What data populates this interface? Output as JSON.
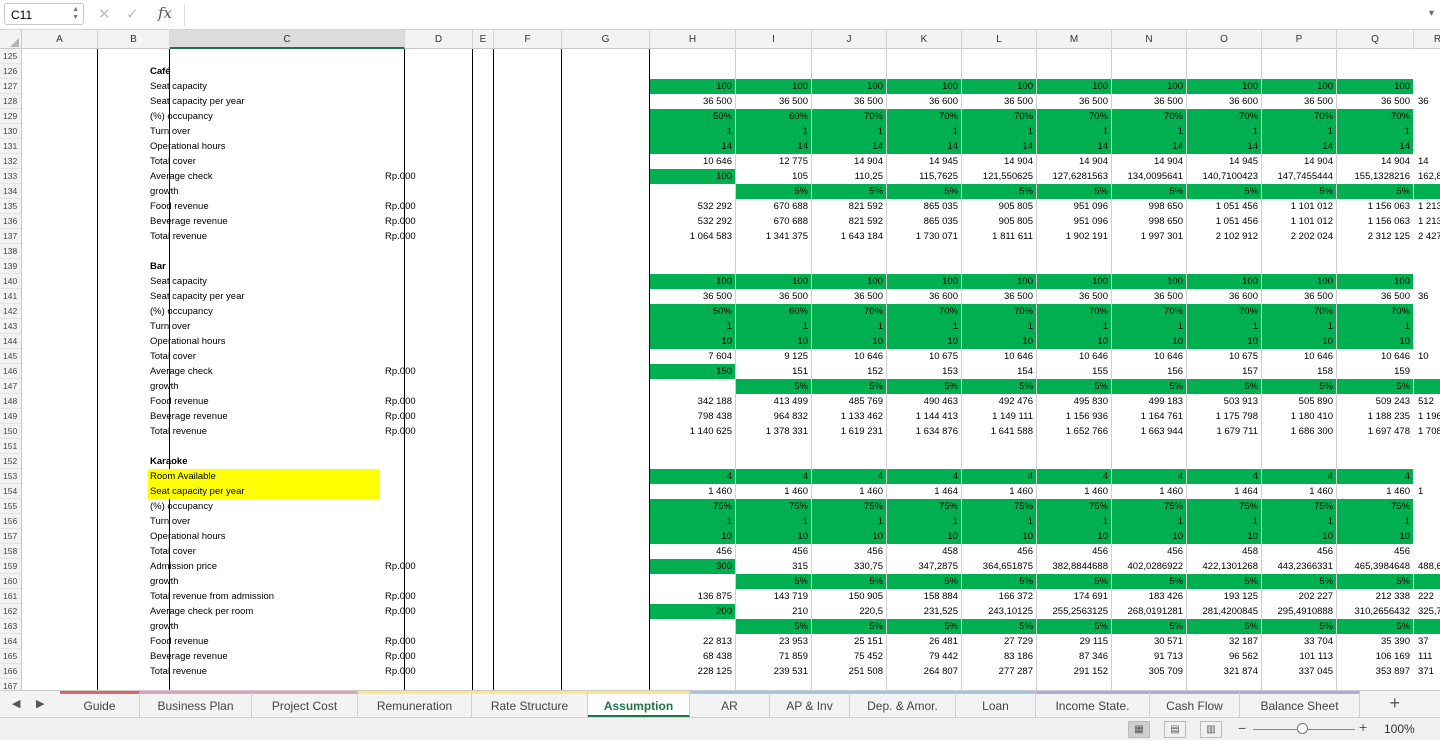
{
  "name_box": "C11",
  "formula_icons": {
    "cancel": "✕",
    "confirm": "✓",
    "fx": "fx",
    "dropdown": "▾"
  },
  "columns": [
    "A",
    "B",
    "C",
    "D",
    "E",
    "F",
    "G",
    "H",
    "I",
    "J",
    "K",
    "L",
    "M",
    "N",
    "O",
    "P",
    "Q",
    "R"
  ],
  "row_start": 125,
  "row_end": 167,
  "sections": [
    {
      "rows": [
        {
          "label": "Café",
          "bold": true
        },
        {
          "label": "Seat capacity",
          "green": true,
          "values": [
            "100",
            "100",
            "100",
            "100",
            "100",
            "100",
            "100",
            "100",
            "100",
            "100",
            ""
          ]
        },
        {
          "label": "Seat capacity per year",
          "values": [
            "36 500",
            "36 500",
            "36 500",
            "36 600",
            "36 500",
            "36 500",
            "36 500",
            "36 600",
            "36 500",
            "36 500",
            "36"
          ]
        },
        {
          "label": "(%) occupancy",
          "green": true,
          "values": [
            "50%",
            "60%",
            "70%",
            "70%",
            "70%",
            "70%",
            "70%",
            "70%",
            "70%",
            "70%",
            ""
          ]
        },
        {
          "label": "Turn over",
          "green": true,
          "values": [
            "1",
            "1",
            "1",
            "1",
            "1",
            "1",
            "1",
            "1",
            "1",
            "1",
            ""
          ]
        },
        {
          "label": "Operational hours",
          "green": true,
          "values": [
            "14",
            "14",
            "14",
            "14",
            "14",
            "14",
            "14",
            "14",
            "14",
            "14",
            ""
          ]
        },
        {
          "label": "Total cover",
          "values": [
            "10 646",
            "12 775",
            "14 904",
            "14 945",
            "14 904",
            "14 904",
            "14 904",
            "14 945",
            "14 904",
            "14 904",
            "14"
          ]
        },
        {
          "label": "Average check",
          "unit": "Rp.000",
          "values": [
            "100",
            "105",
            "110,25",
            "115,7625",
            "121,550625",
            "127,6281563",
            "134,0095641",
            "140,7100423",
            "147,7455444",
            "155,1328216",
            "162,889"
          ],
          "green_first": true
        },
        {
          "label": "growth",
          "green_rest": true,
          "values": [
            "",
            "5%",
            "5%",
            "5%",
            "5%",
            "5%",
            "5%",
            "5%",
            "5%",
            "5%",
            ""
          ]
        },
        {
          "label": "Food revenue",
          "unit": "Rp.000",
          "values": [
            "532 292",
            "670 688",
            "821 592",
            "865 035",
            "905 805",
            "951 096",
            "998 650",
            "1 051 456",
            "1 101 012",
            "1 156 063",
            "1 213"
          ]
        },
        {
          "label": "Beverage revenue",
          "unit": "Rp.000",
          "values": [
            "532 292",
            "670 688",
            "821 592",
            "865 035",
            "905 805",
            "951 096",
            "998 650",
            "1 051 456",
            "1 101 012",
            "1 156 063",
            "1 213"
          ]
        },
        {
          "label": "Total revenue",
          "unit": "Rp.000",
          "values": [
            "1 064 583",
            "1 341 375",
            "1 643 184",
            "1 730 071",
            "1 811 611",
            "1 902 191",
            "1 997 301",
            "2 102 912",
            "2 202 024",
            "2 312 125",
            "2 427"
          ]
        }
      ]
    }
  ],
  "bar_rows": [
    {
      "label": "Bar",
      "bold": true
    },
    {
      "label": "Seat capacity",
      "green": true,
      "values": [
        "100",
        "100",
        "100",
        "100",
        "100",
        "100",
        "100",
        "100",
        "100",
        "100",
        ""
      ]
    },
    {
      "label": "Seat capacity per year",
      "values": [
        "36 500",
        "36 500",
        "36 500",
        "36 600",
        "36 500",
        "36 500",
        "36 500",
        "36 600",
        "36 500",
        "36 500",
        "36"
      ]
    },
    {
      "label": "(%) occupancy",
      "green": true,
      "values": [
        "50%",
        "60%",
        "70%",
        "70%",
        "70%",
        "70%",
        "70%",
        "70%",
        "70%",
        "70%",
        ""
      ]
    },
    {
      "label": "Turn over",
      "green": true,
      "values": [
        "1",
        "1",
        "1",
        "1",
        "1",
        "1",
        "1",
        "1",
        "1",
        "1",
        ""
      ]
    },
    {
      "label": "Operational hours",
      "green": true,
      "values": [
        "10",
        "10",
        "10",
        "10",
        "10",
        "10",
        "10",
        "10",
        "10",
        "10",
        ""
      ]
    },
    {
      "label": "Total cover",
      "values": [
        "7 604",
        "9 125",
        "10 646",
        "10 675",
        "10 646",
        "10 646",
        "10 646",
        "10 675",
        "10 646",
        "10 646",
        "10"
      ]
    },
    {
      "label": "Average check",
      "unit": "Rp.000",
      "values": [
        "150",
        "151",
        "152",
        "153",
        "154",
        "155",
        "156",
        "157",
        "158",
        "159",
        ""
      ],
      "green_first": true
    },
    {
      "label": "growth",
      "green_rest": true,
      "values": [
        "",
        "5%",
        "5%",
        "5%",
        "5%",
        "5%",
        "5%",
        "5%",
        "5%",
        "5%",
        ""
      ]
    },
    {
      "label": "Food revenue",
      "unit": "Rp.000",
      "values": [
        "342 188",
        "413 499",
        "485 769",
        "490 463",
        "492 476",
        "495 830",
        "499 183",
        "503 913",
        "505 890",
        "509 243",
        "512"
      ]
    },
    {
      "label": "Beverage revenue",
      "unit": "Rp.000",
      "values": [
        "798 438",
        "964 832",
        "1 133 462",
        "1 144 413",
        "1 149 111",
        "1 156 936",
        "1 164 761",
        "1 175 798",
        "1 180 410",
        "1 188 235",
        "1 196"
      ]
    },
    {
      "label": "Total revenue",
      "unit": "Rp.000",
      "values": [
        "1 140 625",
        "1 378 331",
        "1 619 231",
        "1 634 876",
        "1 641 588",
        "1 652 766",
        "1 663 944",
        "1 679 711",
        "1 686 300",
        "1 697 478",
        "1 708"
      ]
    }
  ],
  "karaoke_rows": [
    {
      "label": "Karaoke",
      "bold": true
    },
    {
      "label": "Room Available",
      "yellow": true,
      "green": true,
      "values": [
        "4",
        "4",
        "4",
        "4",
        "4",
        "4",
        "4",
        "4",
        "4",
        "4",
        ""
      ]
    },
    {
      "label": "Seat capacity per year",
      "yellow": true,
      "values": [
        "1 460",
        "1 460",
        "1 460",
        "1 464",
        "1 460",
        "1 460",
        "1 460",
        "1 464",
        "1 460",
        "1 460",
        "1"
      ]
    },
    {
      "label": "(%) occupancy",
      "green": true,
      "values": [
        "75%",
        "75%",
        "75%",
        "75%",
        "75%",
        "75%",
        "75%",
        "75%",
        "75%",
        "75%",
        ""
      ]
    },
    {
      "label": "Turn over",
      "green": true,
      "values": [
        "1",
        "1",
        "1",
        "1",
        "1",
        "1",
        "1",
        "1",
        "1",
        "1",
        ""
      ]
    },
    {
      "label": "Operational hours",
      "green": true,
      "values": [
        "10",
        "10",
        "10",
        "10",
        "10",
        "10",
        "10",
        "10",
        "10",
        "10",
        ""
      ]
    },
    {
      "label": "Total cover",
      "values": [
        "456",
        "456",
        "456",
        "458",
        "456",
        "456",
        "456",
        "458",
        "456",
        "456",
        ""
      ]
    },
    {
      "label": "Admission price",
      "unit": "Rp.000",
      "values": [
        "300",
        "315",
        "330,75",
        "347,2875",
        "364,651875",
        "382,8844688",
        "402,0286922",
        "422,1301268",
        "443,2366331",
        "465,3984648",
        "488,66"
      ],
      "green_first": true
    },
    {
      "label": "growth",
      "green_rest": true,
      "values": [
        "",
        "5%",
        "5%",
        "5%",
        "5%",
        "5%",
        "5%",
        "5%",
        "5%",
        "5%",
        ""
      ]
    },
    {
      "label": "Total revenue from admission",
      "unit": "Rp.000",
      "values": [
        "136 875",
        "143 719",
        "150 905",
        "158 884",
        "166 372",
        "174 691",
        "183 426",
        "193 125",
        "202 227",
        "212 338",
        "222"
      ]
    },
    {
      "label": "Average check per room",
      "unit": "Rp.000",
      "values": [
        "200",
        "210",
        "220,5",
        "231,525",
        "243,10125",
        "255,2563125",
        "268,0191281",
        "281,4200845",
        "295,4910888",
        "310,2656432",
        "325,778"
      ],
      "green_first": true
    },
    {
      "label": "growth",
      "green_rest": true,
      "values": [
        "",
        "5%",
        "5%",
        "5%",
        "5%",
        "5%",
        "5%",
        "5%",
        "5%",
        "5%",
        ""
      ]
    },
    {
      "label": "Food revenue",
      "unit": "Rp.000",
      "values": [
        "22 813",
        "23 953",
        "25 151",
        "26 481",
        "27 729",
        "29 115",
        "30 571",
        "32 187",
        "33 704",
        "35 390",
        "37"
      ]
    },
    {
      "label": "Beverage revenue",
      "unit": "Rp.000",
      "values": [
        "68 438",
        "71 859",
        "75 452",
        "79 442",
        "83 186",
        "87 346",
        "91 713",
        "96 562",
        "101 113",
        "106 169",
        "111"
      ]
    },
    {
      "label": "Total revenue",
      "unit": "Rp.000",
      "values": [
        "228 125",
        "239 531",
        "251 508",
        "264 807",
        "277 287",
        "291 152",
        "305 709",
        "321 874",
        "337 045",
        "353 897",
        "371"
      ]
    }
  ],
  "tabs": [
    {
      "label": "Guide",
      "color": "#e06666"
    },
    {
      "label": "Business Plan",
      "color": "#e0a0c0"
    },
    {
      "label": "Project Cost",
      "color": "#e0a0c0"
    },
    {
      "label": "Remuneration",
      "color": "#ffe680"
    },
    {
      "label": "Rate Structure",
      "color": "#ffe680"
    },
    {
      "label": "Assumption",
      "color": "#ffe680",
      "active": true
    },
    {
      "label": "AR",
      "color": "#9fc5e8"
    },
    {
      "label": "AP & Inv",
      "color": "#9fc5e8"
    },
    {
      "label": "Dep. & Amor.",
      "color": "#9fc5e8"
    },
    {
      "label": "Loan",
      "color": "#9fc5e8"
    },
    {
      "label": "Income State.",
      "color": "#b4a7d6"
    },
    {
      "label": "Cash Flow",
      "color": "#b4a7d6"
    },
    {
      "label": "Balance Sheet",
      "color": "#b4a7d6"
    }
  ],
  "add_sheet": "+",
  "zoom": "100%",
  "zoom_minus": "−",
  "zoom_plus": "+",
  "colors": {
    "green": "#00b050",
    "yellow": "#ffff00",
    "accent": "#217346"
  }
}
